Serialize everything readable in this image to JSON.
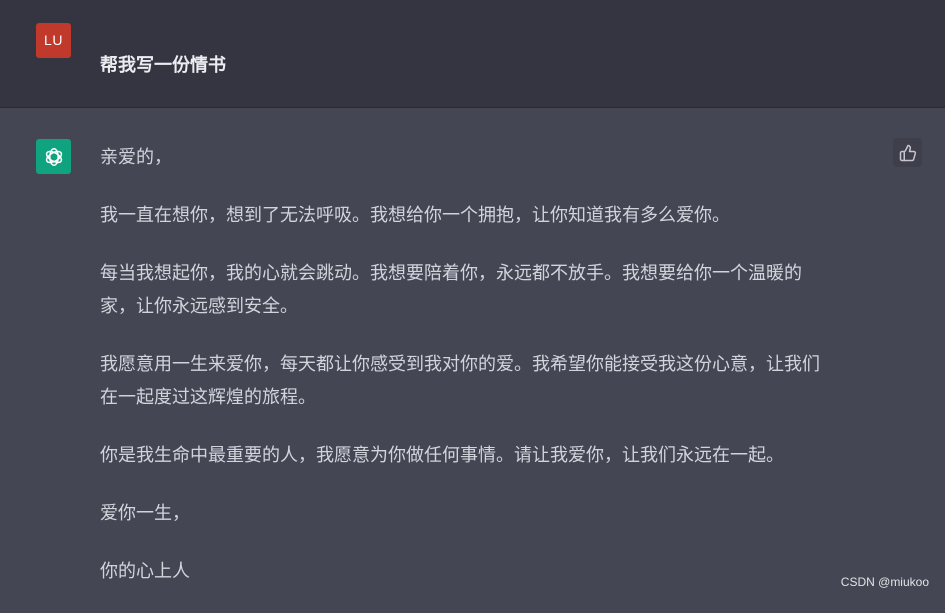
{
  "user": {
    "avatar_initials": "LU",
    "avatar_color": "#c0392b",
    "message": "帮我写一份情书"
  },
  "assistant": {
    "avatar_icon": "openai-logo-icon",
    "avatar_color": "#10a37f",
    "paragraphs": [
      "亲爱的，",
      "我一直在想你，想到了无法呼吸。我想给你一个拥抱，让你知道我有多么爱你。",
      "每当我想起你，我的心就会跳动。我想要陪着你，永远都不放手。我想要给你一个温暖的\n家，让你永远感到安全。",
      "我愿意用一生来爱你，每天都让你感受到我对你的爱。我希望你能接受我这份心意，让我们\n在一起度过这辉煌的旅程。",
      "你是我生命中最重要的人，我愿意为你做任何事情。请让我爱你，让我们永远在一起。",
      "爱你一生，",
      "你的心上人"
    ],
    "feedback_icon": "thumbs-up-icon"
  },
  "watermark": "CSDN @miukoo",
  "colors": {
    "user_bg": "#343541",
    "assistant_bg": "#444654",
    "text": "#d1d5db"
  }
}
